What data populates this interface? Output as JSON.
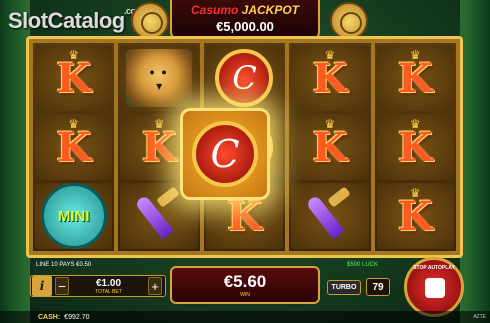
{
  "watermark": {
    "text": "SlotCatalog",
    "suffix": ".com"
  },
  "jackpot": {
    "brand": "Casumo",
    "title": "JACKPOT",
    "amount": "€5,000.00"
  },
  "reels": [
    [
      "K",
      "K",
      "MINI"
    ],
    [
      "jaguar",
      "K",
      "dagger"
    ],
    [
      "C",
      "C",
      "K"
    ],
    [
      "K",
      "K",
      "dagger"
    ],
    [
      "K",
      "K",
      "K"
    ]
  ],
  "line_info": "LINE 10 PAYS €0.50",
  "free_win": "$500 LUCK",
  "bet": {
    "info_label": "i",
    "minus": "−",
    "plus": "+",
    "amount": "€1.00",
    "label": "TOTAL BET"
  },
  "win": {
    "amount": "€5.60",
    "label": "WIN"
  },
  "turbo_label": "TURBO",
  "autoplay_count": "79",
  "stop_autoplay_label": "STOP AUTOPLAY",
  "cash": {
    "label": "CASH:",
    "value": "€992.70"
  },
  "game_tag": "AZTE",
  "colors": {
    "gold": "#d9a53a",
    "k_symbol": "#ff5a1f",
    "win_panel": "#5a0c0c"
  }
}
